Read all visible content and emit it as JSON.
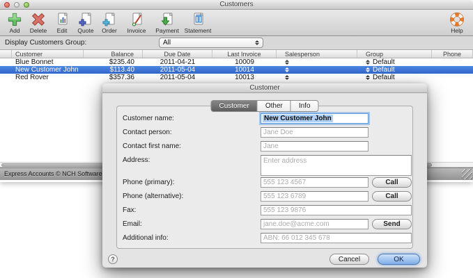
{
  "colors": {
    "selection_blue": "#3b77d8",
    "ok_button_blue": "#7fade9",
    "help_ring_orange": "#e87a2a",
    "selected_text_highlight": "#aed1f8"
  },
  "window": {
    "title": "Customers",
    "status_bar": "Express Accounts © NCH Software"
  },
  "toolbar": {
    "items": [
      {
        "label": "Add",
        "icon": "add-icon"
      },
      {
        "label": "Delete",
        "icon": "delete-icon"
      },
      {
        "label": "Edit",
        "icon": "edit-icon"
      },
      {
        "label": "Quote",
        "icon": "quote-icon"
      },
      {
        "label": "Order",
        "icon": "order-icon"
      },
      {
        "label": "Invoice",
        "icon": "invoice-icon"
      },
      {
        "label": "Payment",
        "icon": "payment-icon"
      },
      {
        "label": "Statement",
        "icon": "statement-icon"
      }
    ],
    "help": {
      "label": "Help",
      "icon": "help-icon"
    }
  },
  "filter": {
    "label": "Display Customers Group:",
    "value": "All"
  },
  "table": {
    "columns": [
      "Customer",
      "Balance",
      "Due Date",
      "Last Invoice",
      "Salesperson",
      "Group",
      "Phone"
    ],
    "rows": [
      {
        "customer": "Blue Bonnet",
        "balance": "$235.40",
        "due_date": "2011-04-21",
        "last_invoice": "10009",
        "salesperson": "",
        "group": "Default",
        "phone": "",
        "selected": false
      },
      {
        "customer": "New Customer John",
        "balance": "$113.40",
        "due_date": "2011-05-04",
        "last_invoice": "10014",
        "salesperson": "",
        "group": "Default",
        "phone": "",
        "selected": true
      },
      {
        "customer": "Red Rover",
        "balance": "$357.36",
        "due_date": "2011-05-04",
        "last_invoice": "10013",
        "salesperson": "",
        "group": "Default",
        "phone": "",
        "selected": false
      }
    ]
  },
  "dialog": {
    "title": "Customer",
    "tabs": [
      {
        "label": "Customer",
        "selected": true
      },
      {
        "label": "Other",
        "selected": false
      },
      {
        "label": "Info",
        "selected": false
      }
    ],
    "fields": [
      {
        "id": "customer-name",
        "label": "Customer name:",
        "value": "New Customer John",
        "control": "text",
        "focused": true
      },
      {
        "id": "contact-person",
        "label": "Contact person:",
        "placeholder": "Jane Doe",
        "control": "text"
      },
      {
        "id": "contact-first-name",
        "label": "Contact first name:",
        "placeholder": "Jane",
        "control": "text"
      },
      {
        "id": "address",
        "label": "Address:",
        "placeholder": "Enter address",
        "control": "textarea",
        "wide": true
      },
      {
        "id": "phone-primary",
        "label": "Phone (primary):",
        "placeholder": "555 123 4567",
        "control": "text",
        "button": "Call"
      },
      {
        "id": "phone-alternative",
        "label": "Phone (alternative):",
        "placeholder": "555 123 6789",
        "control": "text",
        "button": "Call"
      },
      {
        "id": "fax",
        "label": "Fax:",
        "placeholder": "555 123 9876",
        "control": "text",
        "wide": true
      },
      {
        "id": "email",
        "label": "Email:",
        "placeholder": "jane.doe@acme.com",
        "control": "text",
        "button": "Send"
      },
      {
        "id": "additional-info",
        "label": "Additional info:",
        "placeholder": "ABN: 66 012 345 678",
        "control": "text",
        "wide": true
      }
    ],
    "buttons": {
      "help": "?",
      "cancel": "Cancel",
      "ok": "OK"
    }
  }
}
